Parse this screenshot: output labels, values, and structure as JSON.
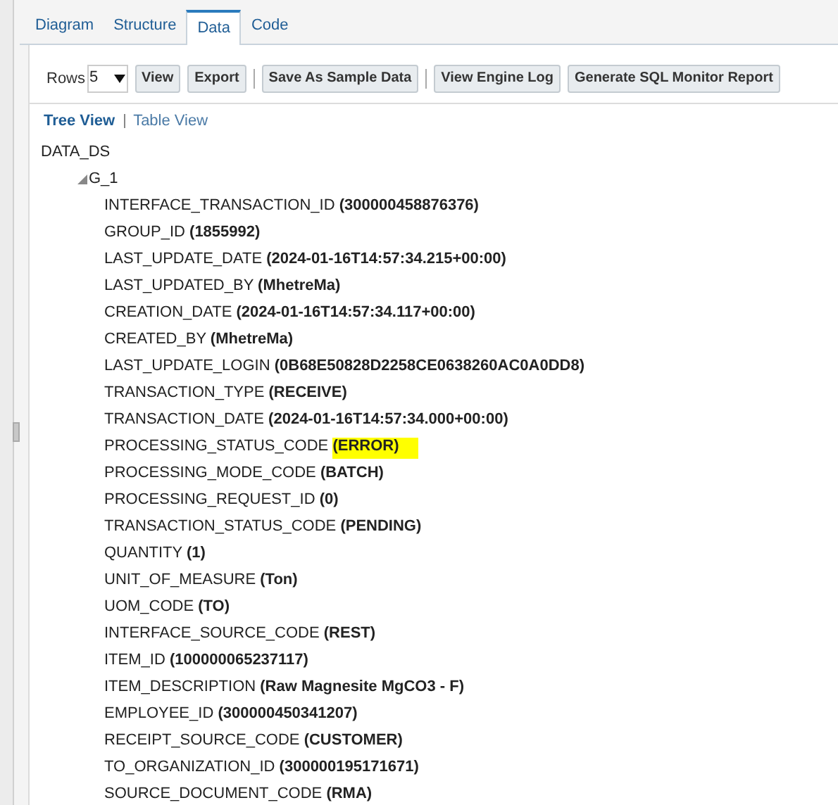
{
  "tabs": [
    {
      "label": "Diagram",
      "selected": false
    },
    {
      "label": "Structure",
      "selected": false
    },
    {
      "label": "Data",
      "selected": true
    },
    {
      "label": "Code",
      "selected": false
    }
  ],
  "toolbar": {
    "rows_label": "Rows",
    "rows_value": "5",
    "buttons": [
      {
        "label": "View",
        "separator_after": false
      },
      {
        "label": "Export",
        "separator_after": true
      },
      {
        "label": "Save As Sample Data",
        "separator_after": true
      },
      {
        "label": "View Engine Log",
        "separator_after": false
      },
      {
        "label": "Generate SQL Monitor Report",
        "separator_after": false
      }
    ]
  },
  "view_links": [
    {
      "label": "Tree View",
      "selected": true
    },
    {
      "label": "Table View",
      "selected": false
    }
  ],
  "tree": {
    "root": "DATA_DS",
    "group": {
      "label": "G_1",
      "expanded": true,
      "fields": [
        {
          "name": "INTERFACE_TRANSACTION_ID",
          "value": "(300000458876376)",
          "highlighted": false
        },
        {
          "name": "GROUP_ID",
          "value": "(1855992)",
          "highlighted": false
        },
        {
          "name": "LAST_UPDATE_DATE",
          "value": "(2024-01-16T14:57:34.215+00:00)",
          "highlighted": false
        },
        {
          "name": "LAST_UPDATED_BY",
          "value": "(MhetreMa)",
          "highlighted": false
        },
        {
          "name": "CREATION_DATE",
          "value": "(2024-01-16T14:57:34.117+00:00)",
          "highlighted": false
        },
        {
          "name": "CREATED_BY",
          "value": "(MhetreMa)",
          "highlighted": false
        },
        {
          "name": "LAST_UPDATE_LOGIN",
          "value": "(0B68E50828D2258CE0638260AC0A0DD8)",
          "highlighted": false
        },
        {
          "name": "TRANSACTION_TYPE",
          "value": "(RECEIVE)",
          "highlighted": false
        },
        {
          "name": "TRANSACTION_DATE",
          "value": "(2024-01-16T14:57:34.000+00:00)",
          "highlighted": false
        },
        {
          "name": "PROCESSING_STATUS_CODE",
          "value": "(ERROR)",
          "highlighted": true
        },
        {
          "name": "PROCESSING_MODE_CODE",
          "value": "(BATCH)",
          "highlighted": false
        },
        {
          "name": "PROCESSING_REQUEST_ID",
          "value": "(0)",
          "highlighted": false
        },
        {
          "name": "TRANSACTION_STATUS_CODE",
          "value": "(PENDING)",
          "highlighted": false
        },
        {
          "name": "QUANTITY",
          "value": "(1)",
          "highlighted": false
        },
        {
          "name": "UNIT_OF_MEASURE",
          "value": "(Ton)",
          "highlighted": false
        },
        {
          "name": "UOM_CODE",
          "value": "(TO)",
          "highlighted": false
        },
        {
          "name": "INTERFACE_SOURCE_CODE",
          "value": "(REST)",
          "highlighted": false
        },
        {
          "name": "ITEM_ID",
          "value": "(100000065237117)",
          "highlighted": false
        },
        {
          "name": "ITEM_DESCRIPTION",
          "value": "(Raw Magnesite MgCO3 - F)",
          "highlighted": false
        },
        {
          "name": "EMPLOYEE_ID",
          "value": "(300000450341207)",
          "highlighted": false
        },
        {
          "name": "RECEIPT_SOURCE_CODE",
          "value": "(CUSTOMER)",
          "highlighted": false
        },
        {
          "name": "TO_ORGANIZATION_ID",
          "value": "(300000195171671)",
          "highlighted": false
        },
        {
          "name": "SOURCE_DOCUMENT_CODE",
          "value": "(RMA)",
          "highlighted": false
        }
      ]
    }
  }
}
